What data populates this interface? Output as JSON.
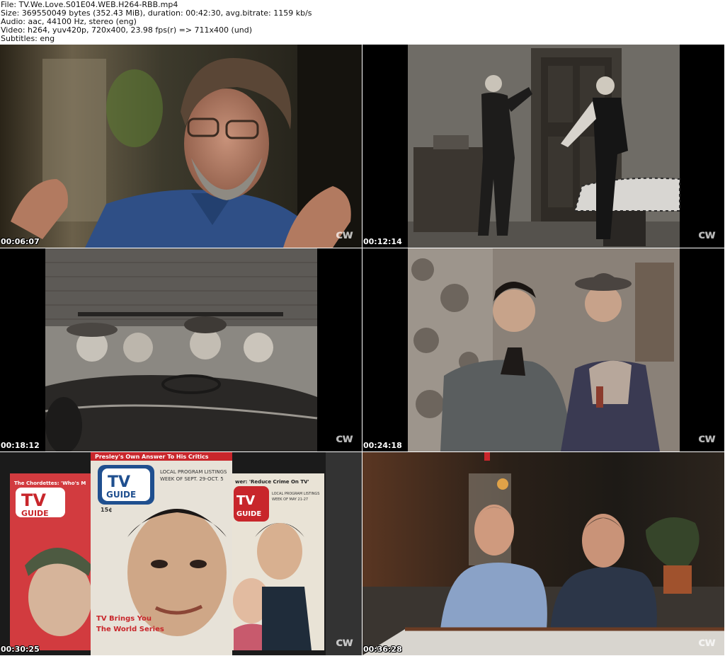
{
  "header": {
    "lines": [
      "File: TV.We.Love.S01E04.WEB.H264-RBB.mp4",
      "Size: 369550049 bytes (352.43 MiB), duration: 00:42:30, avg.bitrate: 1159 kb/s",
      "Audio: aac, 44100 Hz, stereo (eng)",
      "Video: h264, yuv420p, 720x400, 23.98 fps(r) => 711x400 (und)",
      "Subtitles: eng"
    ]
  },
  "thumbnails": [
    {
      "timestamp": "00:06:07",
      "watermark": "cw",
      "scene": "color-interview-man-glasses"
    },
    {
      "timestamp": "00:12:14",
      "watermark": "cw",
      "scene": "bw-two-men-by-door"
    },
    {
      "timestamp": "00:18:12",
      "watermark": "cw",
      "scene": "bw-convertible-car"
    },
    {
      "timestamp": "00:24:18",
      "watermark": "cw",
      "scene": "color-two-men-costume"
    },
    {
      "timestamp": "00:30:25",
      "watermark": "cw",
      "scene": "tv-guide-magazine-covers"
    },
    {
      "timestamp": "00:36:28",
      "watermark": "cw",
      "scene": "color-two-men-interview"
    }
  ],
  "magazines": {
    "left": {
      "logo_top": "TV",
      "logo_bottom": "GUIDE",
      "headline": "The Chordettes: 'Who's M"
    },
    "center": {
      "logo_top": "TV",
      "logo_bottom": "GUIDE",
      "headline": "Presley's Own Answer To His Critics",
      "listing": "LOCAL PROGRAM LISTINGS",
      "week": "WEEK OF SEPT. 29-OCT. 5",
      "price": "15¢",
      "cover_line_1": "TV Brings You",
      "cover_line_2": "The World Series"
    },
    "right": {
      "logo_top": "TV",
      "logo_bottom": "GUIDE",
      "headline": "wer: 'Reduce Crime On TV'",
      "listing": "LOCAL PROGRAM LISTINGS",
      "week": "WEEK OF MAY 21-27"
    }
  },
  "colors": {
    "tv_guide_red": "#c8262b",
    "tv_guide_blue": "#1f4f8f",
    "background": "#ffffff"
  }
}
